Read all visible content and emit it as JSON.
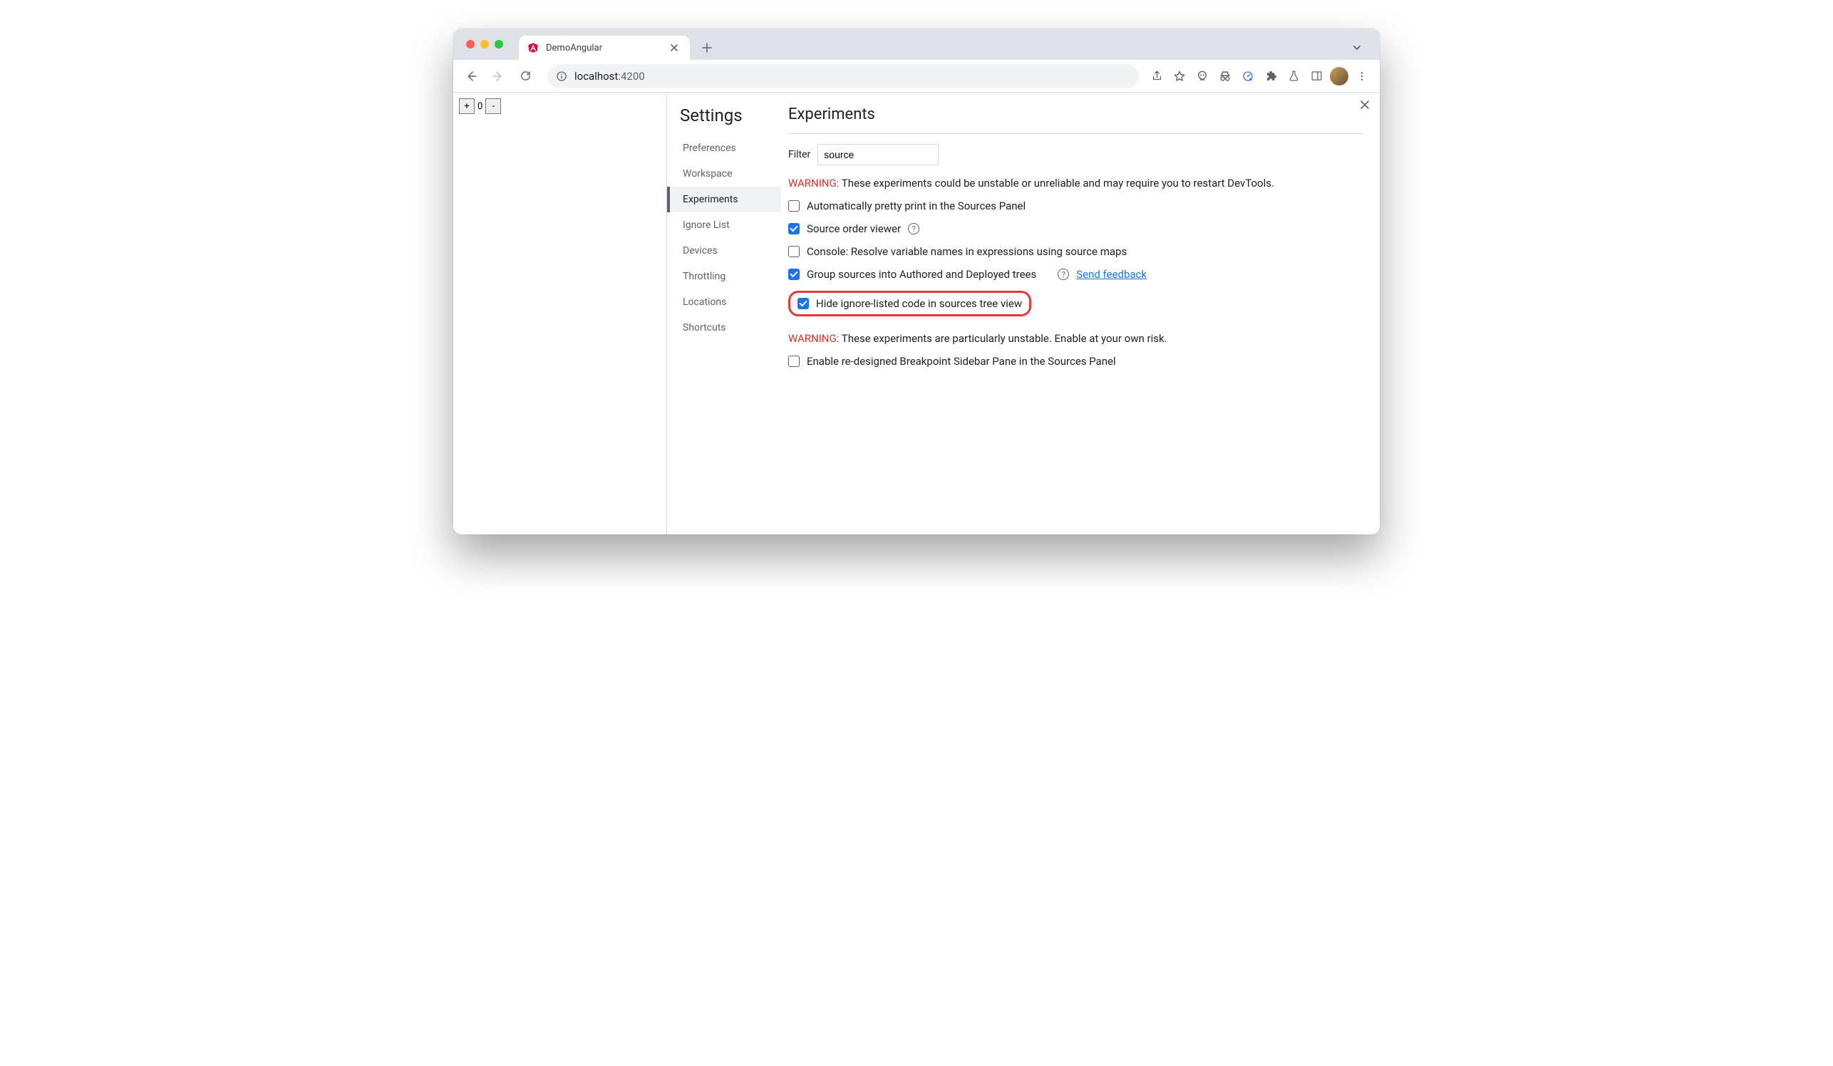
{
  "browser": {
    "tab_title": "DemoAngular",
    "url_host": "localhost",
    "url_port": ":4200"
  },
  "page": {
    "counter_value": "0",
    "plus": "+",
    "minus": "-"
  },
  "settings": {
    "title": "Settings",
    "nav": {
      "preferences": "Preferences",
      "workspace": "Workspace",
      "experiments": "Experiments",
      "ignore_list": "Ignore List",
      "devices": "Devices",
      "throttling": "Throttling",
      "locations": "Locations",
      "shortcuts": "Shortcuts"
    },
    "experiments": {
      "heading": "Experiments",
      "filter_label": "Filter",
      "filter_value": "source",
      "warning1_prefix": "WARNING:",
      "warning1_text": " These experiments could be unstable or unreliable and may require you to restart DevTools.",
      "warning2_prefix": "WARNING:",
      "warning2_text": " These experiments are particularly unstable. Enable at your own risk.",
      "items": {
        "auto_pretty": "Automatically pretty print in the Sources Panel",
        "source_order": "Source order viewer",
        "console_resolve": "Console: Resolve variable names in expressions using source maps",
        "group_sources": "Group sources into Authored and Deployed trees",
        "send_feedback": "Send feedback",
        "hide_ignore": "Hide ignore-listed code in sources tree view",
        "bp_sidebar": "Enable re-designed Breakpoint Sidebar Pane in the Sources Panel"
      }
    }
  }
}
